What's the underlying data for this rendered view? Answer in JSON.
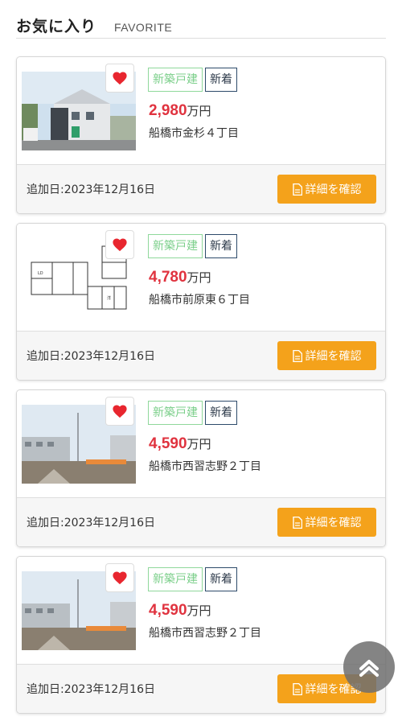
{
  "header": {
    "title": "お気に入り",
    "subtitle": "FAVORITE"
  },
  "labels": {
    "tag_newbuild": "新築戸建",
    "tag_newarrival": "新着",
    "price_unit": "万円",
    "detail_button": "詳細を確認"
  },
  "listings": [
    {
      "price": "2,980",
      "address": "船橋市金杉４丁目",
      "added": "追加日:2023年12月16日",
      "photo": "house-exterior-photo"
    },
    {
      "price": "4,780",
      "address": "船橋市前原東６丁目",
      "added": "追加日:2023年12月16日",
      "photo": "floor-plan-image"
    },
    {
      "price": "4,590",
      "address": "船橋市西習志野２丁目",
      "added": "追加日:2023年12月16日",
      "photo": "vacant-lot-photo"
    },
    {
      "price": "4,590",
      "address": "船橋市西習志野２丁目",
      "added": "追加日:2023年12月16日",
      "photo": "vacant-lot-photo"
    }
  ],
  "icons": {
    "favorite": "heart-icon",
    "document": "document-icon",
    "scroll_top": "chevron-up-icon"
  },
  "colors": {
    "price": "#e0333f",
    "heart": "#e8262f",
    "detail_button": "#f4a21b",
    "tag_newbuild": "#7bcf8a",
    "tag_newarrival": "#2d4a6a"
  }
}
